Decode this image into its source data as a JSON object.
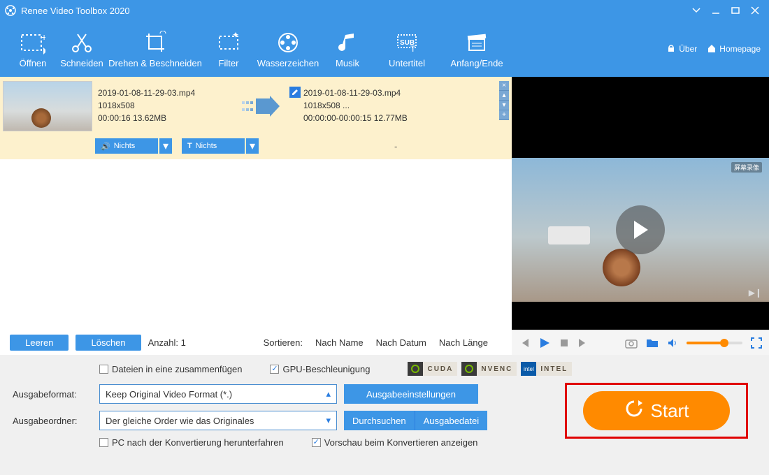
{
  "titlebar": {
    "title": "Renee Video Toolbox 2020"
  },
  "toolbar": {
    "open": "Öffnen",
    "cut": "Schneiden",
    "rotate": "Drehen & Beschneiden",
    "filter": "Filter",
    "watermark": "Wasserzeichen",
    "music": "Musik",
    "subtitle": "Untertitel",
    "startend": "Anfang/Ende",
    "about": "Über",
    "homepage": "Homepage"
  },
  "file": {
    "in_name": "2019-01-08-11-29-03.mp4",
    "in_res": "1018x508",
    "in_dur": "00:00:16  13.62MB",
    "out_name": "2019-01-08-11-29-03.mp4",
    "out_res": "1018x508   ...",
    "out_range": "00:00:00-00:00:15  12.77MB",
    "audio_drop": "Nichts",
    "text_drop": "Nichts",
    "dash": "-"
  },
  "listbar": {
    "clear": "Leeren",
    "delete": "Löschen",
    "count": "Anzahl: 1",
    "sort_label": "Sortieren:",
    "sort_name": "Nach Name",
    "sort_date": "Nach Datum",
    "sort_len": "Nach Länge"
  },
  "bottom": {
    "merge": "Dateien in eine zusammenfügen",
    "gpu": "GPU-Beschleunigung",
    "cuda": "CUDA",
    "nvenc": "NVENC",
    "intel": "INTEL",
    "outformat_lbl": "Ausgabeformat:",
    "outformat_val": "Keep Original Video Format (*.)",
    "outsettings": "Ausgabeeinstellungen",
    "outfolder_lbl": "Ausgabeordner:",
    "outfolder_val": "Der gleiche Order wie das Originales",
    "browse": "Durchsuchen",
    "outfile": "Ausgabedatei",
    "shutdown": "PC nach der Konvertierung herunterfahren",
    "previewconv": "Vorschau beim Konvertieren anzeigen",
    "start": "Start"
  },
  "preview": {
    "wm": "屏幕录像"
  }
}
